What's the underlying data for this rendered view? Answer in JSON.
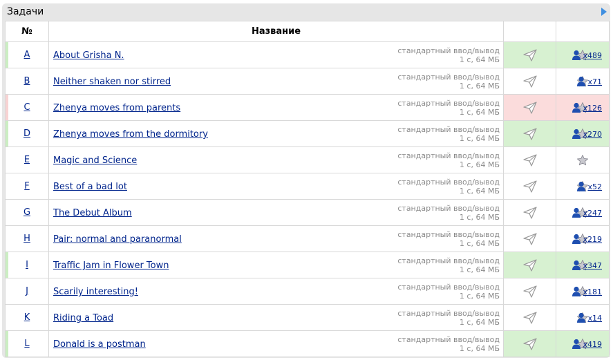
{
  "panel": {
    "title": "Задачи",
    "toggle_icon": "triangle-right-icon",
    "accent_color": "#3f8fe0"
  },
  "table": {
    "headers": {
      "number": "№",
      "name": "Название"
    },
    "limits_line1": "стандартный ввод/вывод",
    "limits_line2": "1 с, 64 МБ"
  },
  "status_colors": {
    "ok": "#d7f1d1",
    "wrong": "#fbdcdc"
  },
  "problems": [
    {
      "letter": "A",
      "title": "About Grisha N.",
      "status": "ok",
      "solved": "x489"
    },
    {
      "letter": "B",
      "title": "Neither shaken nor stirred",
      "status": "none",
      "solved": "x71"
    },
    {
      "letter": "C",
      "title": "Zhenya moves from parents",
      "status": "wa",
      "solved": "x126"
    },
    {
      "letter": "D",
      "title": "Zhenya moves from the dormitory",
      "status": "ok",
      "solved": "x270"
    },
    {
      "letter": "E",
      "title": "Magic and Science",
      "status": "none",
      "solved": ""
    },
    {
      "letter": "F",
      "title": "Best of a bad lot",
      "status": "none",
      "solved": "x52"
    },
    {
      "letter": "G",
      "title": "The Debut Album",
      "status": "none",
      "solved": "x247"
    },
    {
      "letter": "H",
      "title": "Pair: normal and paranormal",
      "status": "none",
      "solved": "x219"
    },
    {
      "letter": "I",
      "title": "Traffic Jam in Flower Town",
      "status": "ok",
      "solved": "x347"
    },
    {
      "letter": "J",
      "title": "Scarily interesting!",
      "status": "none",
      "solved": "x181"
    },
    {
      "letter": "K",
      "title": "Riding a Toad",
      "status": "none",
      "solved": "x14"
    },
    {
      "letter": "L",
      "title": "Donald is a postman",
      "status": "ok",
      "solved": "x419"
    }
  ]
}
